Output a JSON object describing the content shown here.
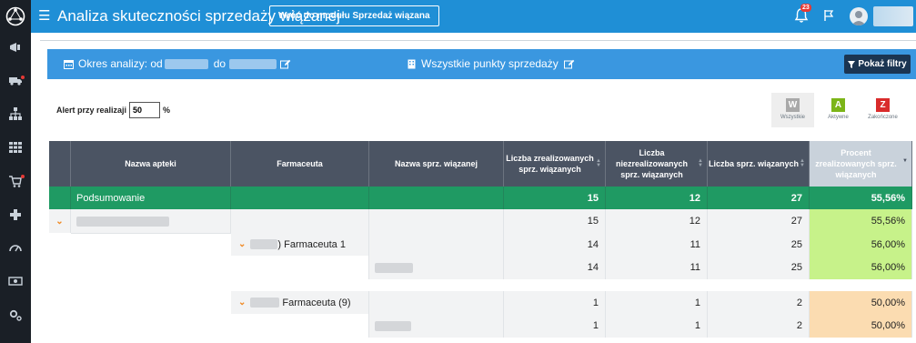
{
  "app": {
    "title": "Analiza skuteczności sprzedaży wiązanej",
    "back_label": "Wróć do modułu Sprzedaż wiązana",
    "notification_count": "23",
    "icon_menu": "hamburger-icon",
    "icon_notifications": "bell-icon",
    "icon_flag": "flag-icon",
    "icon_user": "user-avatar-icon"
  },
  "sidebar": {
    "items": [
      {
        "icon": "campaign-icon"
      },
      {
        "icon": "delivery-truck-icon"
      },
      {
        "icon": "org-structure-icon"
      },
      {
        "icon": "grid-icon"
      },
      {
        "icon": "cart-icon"
      },
      {
        "icon": "plus-icon"
      },
      {
        "icon": "speedometer-icon"
      },
      {
        "icon": "money-icon"
      },
      {
        "icon": "settings-icon"
      }
    ]
  },
  "filters": {
    "period_label": "Okres analizy: od",
    "to_label": "do",
    "points_label": "Wszystkie punkty sprzedaży",
    "show_filters_label": "Pokaż filtry"
  },
  "alert": {
    "label": "Alert przy realizaji",
    "value": "50",
    "unit": "%"
  },
  "status_filters": [
    {
      "letter": "W",
      "label": "Wszystkie",
      "color": "#a9a9a9"
    },
    {
      "letter": "A",
      "label": "Aktywne",
      "color": "#7cb518"
    },
    {
      "letter": "Z",
      "label": "Zakończone",
      "color": "#d92b2b"
    }
  ],
  "colors": {
    "topbar": "#1f8fd6",
    "sidebar": "#1a1f26",
    "summary_row": "#1f9a63",
    "ok_cell": "#c7f28a",
    "warn_cell": "#fbdcb1",
    "header": "#4b5463"
  },
  "table": {
    "headers": [
      "Nazwa apteki",
      "Farmaceuta",
      "Nazwa sprz. wiązanej",
      "Liczba zrealizowanych sprz. wiązanych",
      "Liczba niezrealizowanych sprz. wiązanych",
      "Liczba sprz. wiązanych",
      "Procent zrealizowanych sprz. wiązanych"
    ],
    "summary": {
      "label": "Podsumowanie",
      "realized": "15",
      "unrealized": "12",
      "total": "27",
      "percent": "55,56%"
    },
    "rows": [
      {
        "realized": "15",
        "unrealized": "12",
        "total": "27",
        "percent": "55,56%"
      },
      {
        "pharmacist": ") Farmaceuta 1",
        "realized": "14",
        "unrealized": "11",
        "total": "25",
        "percent": "56,00%"
      },
      {
        "realized": "14",
        "unrealized": "11",
        "total": "25",
        "percent": "56,00%"
      },
      {
        "pharmacist": "Farmaceuta (9)",
        "realized": "1",
        "unrealized": "1",
        "total": "2",
        "percent": "50,00%"
      },
      {
        "realized": "1",
        "unrealized": "1",
        "total": "2",
        "percent": "50,00%"
      }
    ]
  }
}
